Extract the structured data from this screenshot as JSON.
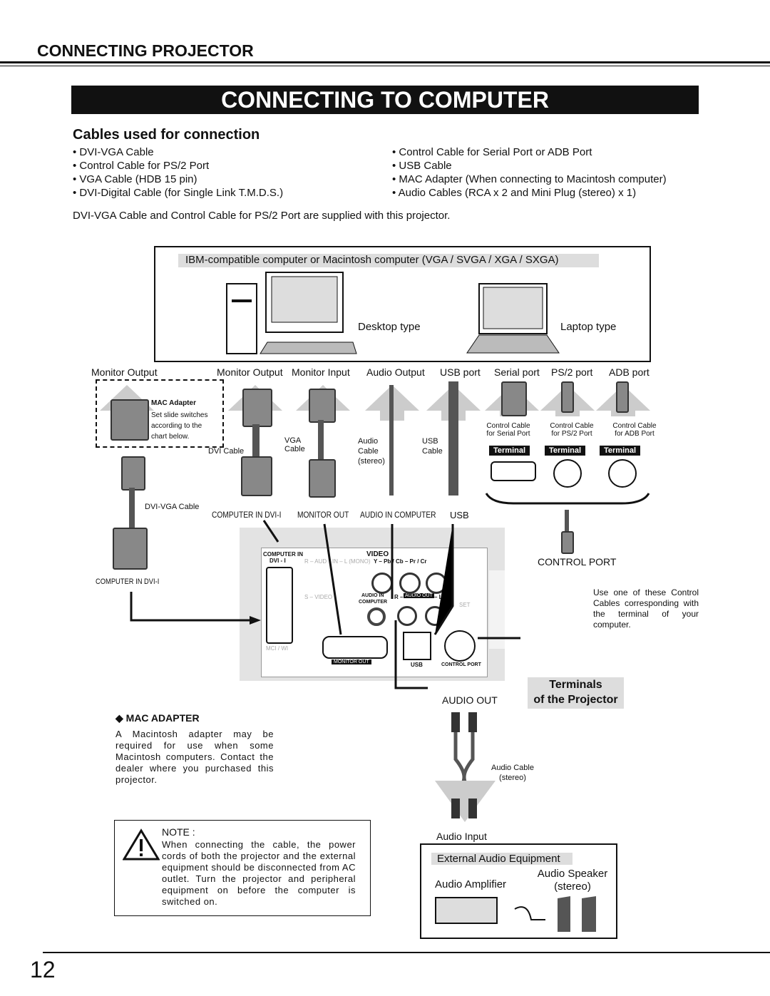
{
  "section": "CONNECTING PROJECTOR",
  "title": "CONNECTING TO COMPUTER",
  "cables": {
    "heading": "Cables used for connection",
    "left": [
      "• DVI-VGA Cable",
      "• Control Cable for PS/2 Port",
      "• VGA Cable (HDB 15 pin)",
      "• DVI-Digital Cable (for Single Link T.M.D.S.)"
    ],
    "right": [
      "• Control Cable for Serial Port or ADB Port",
      "• USB Cable",
      "• MAC Adapter (When connecting to Macintosh computer)",
      "• Audio Cables (RCA x 2 and Mini Plug (stereo) x 1)"
    ],
    "note": "DVI-VGA Cable and Control Cable for PS/2 Port are supplied with this projector."
  },
  "computer": {
    "label": "IBM-compatible computer or Macintosh computer (VGA / SVGA / XGA / SXGA)",
    "desktop": "Desktop type",
    "laptop": "Laptop type"
  },
  "ports": [
    "Monitor Output",
    "Monitor Output",
    "Monitor Input",
    "Audio Output",
    "USB port",
    "Serial port",
    "PS/2 port",
    "ADB port"
  ],
  "mac_box": {
    "title": "MAC Adapter",
    "text": "Set slide switches according to the chart below."
  },
  "cable_labels": {
    "dvi": "DVI Cable",
    "vga": "VGA Cable",
    "audio": "Audio Cable (stereo)",
    "usb": "USB Cable",
    "dvivga": "DVI-VGA Cable",
    "ctrl_serial": "Control Cable for Serial Port",
    "ctrl_ps2": "Control Cable for PS/2 Port",
    "ctrl_adb": "Control Cable for ADB Port",
    "terminal": "Terminal"
  },
  "proj_labels": {
    "comp_dvi": "COMPUTER IN DVI-I",
    "monitor_out": "MONITOR OUT",
    "audio_in": "AUDIO IN COMPUTER",
    "usb": "USB",
    "comp_dvi_left": "COMPUTER IN DVI-I",
    "control_port": "CONTROL PORT",
    "audio_out": "AUDIO OUT"
  },
  "panel": {
    "computer_in": "COMPUTER IN",
    "dvi": "DVI - I",
    "r_audio": "R – AUD",
    "in_l": "IN – L (MONO)",
    "video": "VIDEO",
    "ypbpr": "Y – Pb / Cb – Pr / Cr",
    "svideo": "S – VIDEO",
    "audio_in": "AUDIO IN",
    "computer": "COMPUTER",
    "r": "R –",
    "audio_out": "AUDIO OUT",
    "l": "– L",
    "set": "SET",
    "mci": "MCI / WI",
    "monitor_out": "MONITOR OUT",
    "usb": "USB",
    "control_port": "CONTROL PORT"
  },
  "control_note": "Use one of these Control Cables corresponding with the terminal of your computer.",
  "terminals": [
    "Terminals",
    "of the Projector"
  ],
  "mac": {
    "heading": "MAC ADAPTER",
    "text": "A Macintosh adapter may be required for use when some Macintosh computers. Contact the dealer where you purchased this projector."
  },
  "audio_cable": "Audio Cable (stereo)",
  "audio_input": "Audio Input",
  "external": {
    "label": "External Audio Equipment",
    "amp": "Audio Amplifier",
    "speaker": "Audio Speaker (stereo)"
  },
  "note": {
    "title": "NOTE :",
    "text": "When connecting the cable, the power cords of both the projector and the external equipment should be disconnected from AC outlet. Turn the projector and peripheral equipment on before the computer is switched on."
  },
  "page_number": "12"
}
